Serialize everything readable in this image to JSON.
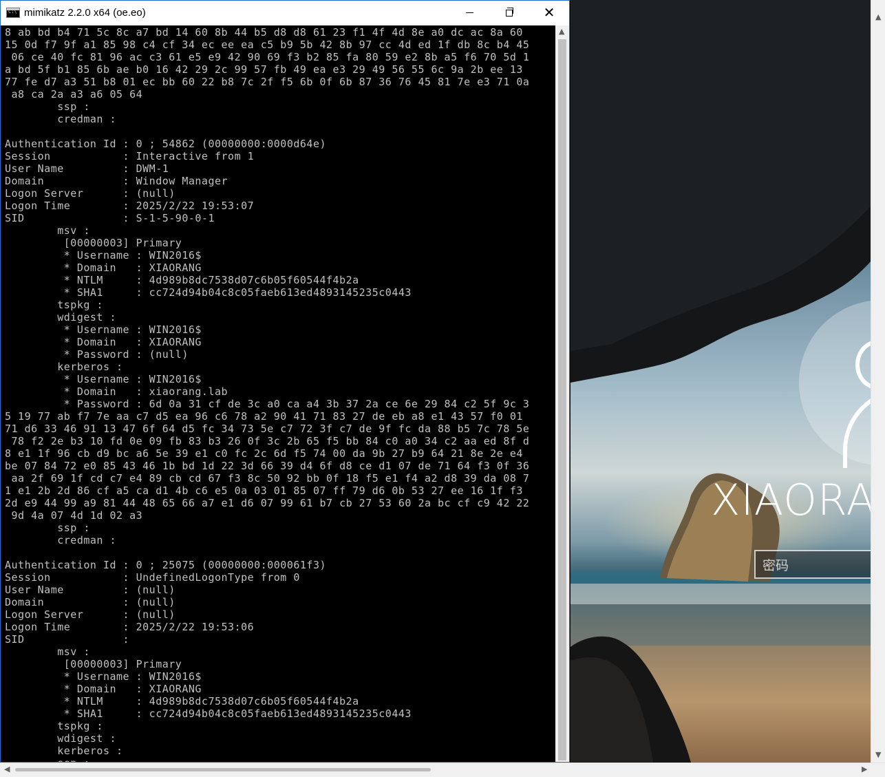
{
  "window": {
    "title": "mimikatz 2.2.0 x64 (oe.eo)",
    "controls": {
      "minimize": "minimize-icon",
      "maximize": "restore-icon",
      "close": "close-icon"
    }
  },
  "console": {
    "lines": [
      "8 ab bd b4 71 5c 8c a7 bd 14 60 8b 44 b5 d8 d8 61 23 f1 4f 4d 8e a0 dc ac 8a 60",
      "15 0d f7 9f a1 85 98 c4 cf 34 ec ee ea c5 b9 5b 42 8b 97 cc 4d ed 1f db 8c b4 45",
      " 06 ce 40 fc 81 96 ac c3 61 e5 e9 42 90 69 f3 b2 85 fa 80 59 e2 8b a5 f6 70 5d 1",
      "a bd 5f b1 85 6b ae b0 16 42 29 2c 99 57 fb 49 ea e3 29 49 56 55 6c 9a 2b ee 13",
      "77 fe d7 a3 51 b8 01 ec bb 60 22 b8 7c 2f f5 6b 0f 6b 87 36 76 45 81 7e e3 71 0a",
      " a8 ca 2a a3 a6 05 64",
      "        ssp :",
      "        credman :",
      "",
      "Authentication Id : 0 ; 54862 (00000000:0000d64e)",
      "Session           : Interactive from 1",
      "User Name         : DWM-1",
      "Domain            : Window Manager",
      "Logon Server      : (null)",
      "Logon Time        : 2025/2/22 19:53:07",
      "SID               : S-1-5-90-0-1",
      "        msv :",
      "         [00000003] Primary",
      "         * Username : WIN2016$",
      "         * Domain   : XIAORANG",
      "         * NTLM     : 4d989b8dc7538d07c6b05f60544f4b2a",
      "         * SHA1     : cc724d94b04c8c05faeb613ed4893145235c0443",
      "        tspkg :",
      "        wdigest :",
      "         * Username : WIN2016$",
      "         * Domain   : XIAORANG",
      "         * Password : (null)",
      "        kerberos :",
      "         * Username : WIN2016$",
      "         * Domain   : xiaorang.lab",
      "         * Password : 6d 0a 31 cf de 3c a0 ca a4 3b 37 2a ce 6e 29 84 c2 5f 9c 3",
      "5 19 77 ab f7 7e aa c7 d5 ea 96 c6 78 a2 90 41 71 83 27 de eb a8 e1 43 57 f0 01",
      "71 d6 33 46 91 13 47 6f 64 d5 fc 34 73 5e c7 72 3f c7 de 9f fc da 88 b5 7c 78 5e",
      " 78 f2 2e b3 10 fd 0e 09 fb 83 b3 26 0f 3c 2b 65 f5 bb 84 c0 a0 34 c2 aa ed 8f d",
      "8 e1 1f 96 cb d9 bc a6 5e 39 e1 c0 fc 2c 6d f5 74 00 da 9b 27 b9 64 21 8e 2e e4",
      "be 07 84 72 e0 85 43 46 1b bd 1d 22 3d 66 39 d4 6f d8 ce d1 07 de 71 64 f3 0f 36",
      " aa 2f 69 1f cd c7 e4 89 cb cd 67 f3 8c 50 92 bb 0f 18 f5 e1 f4 a2 d8 39 da 08 7",
      "1 e1 2b 2d 86 cf a5 ca d1 4b c6 e5 0a 03 01 85 07 ff 79 d6 0b 53 27 ee 16 1f f3",
      "2d e9 44 99 a9 81 44 48 65 66 a7 e1 d6 07 99 61 b7 cb 27 53 60 2a bc cf c9 42 22",
      " 9d 4a 07 4d 1d 02 a3",
      "        ssp :",
      "        credman :",
      "",
      "Authentication Id : 0 ; 25075 (00000000:000061f3)",
      "Session           : UndefinedLogonType from 0",
      "User Name         : (null)",
      "Domain            : (null)",
      "Logon Server      : (null)",
      "Logon Time        : 2025/2/22 19:53:06",
      "SID               :",
      "        msv :",
      "         [00000003] Primary",
      "         * Username : WIN2016$",
      "         * Domain   : XIAORANG",
      "         * NTLM     : 4d989b8dc7538d07c6b05f60544f4b2a",
      "         * SHA1     : cc724d94b04c8c05faeb613ed4893145235c0443",
      "        tspkg :",
      "        wdigest :",
      "        kerberos :",
      "        ssp :"
    ]
  },
  "lockscreen": {
    "username": "XIAORAN",
    "password_placeholder": "密码",
    "avatar_icon": "user-avatar-icon"
  },
  "colors": {
    "console_bg": "#000000",
    "console_fg": "#c0c0c0",
    "window_border": "#1f6bd4",
    "titlebar_bg": "#ffffff"
  }
}
